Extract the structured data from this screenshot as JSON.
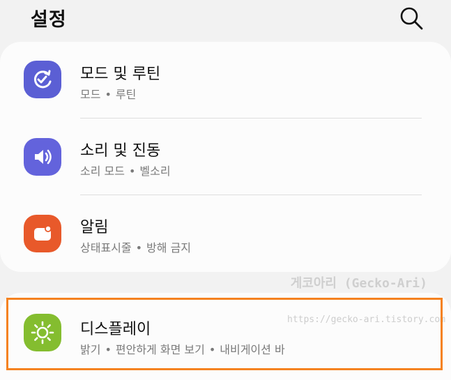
{
  "header": {
    "title": "설정",
    "search_icon": "search-icon"
  },
  "items": [
    {
      "title": "모드 및 루틴",
      "sub": [
        "모드",
        "루틴"
      ],
      "icon": "modes-routines-icon",
      "color": "#5b5fd4"
    },
    {
      "title": "소리 및 진동",
      "sub": [
        "소리 모드",
        "벨소리"
      ],
      "icon": "speaker-icon",
      "color": "#6363dc"
    },
    {
      "title": "알림",
      "sub": [
        "상태표시줄",
        "방해 금지"
      ],
      "icon": "notification-icon",
      "color": "#e8592a"
    },
    {
      "title": "디스플레이",
      "sub": [
        "밝기",
        "편안하게 화면 보기",
        "내비게이션 바"
      ],
      "icon": "brightness-icon",
      "color": "#84bd2f"
    }
  ],
  "separator": "•",
  "watermark": {
    "name": "게코아리 (Gecko-Ari)",
    "url": "https://gecko-ari.tistory.com"
  },
  "highlight_color": "#f58220"
}
